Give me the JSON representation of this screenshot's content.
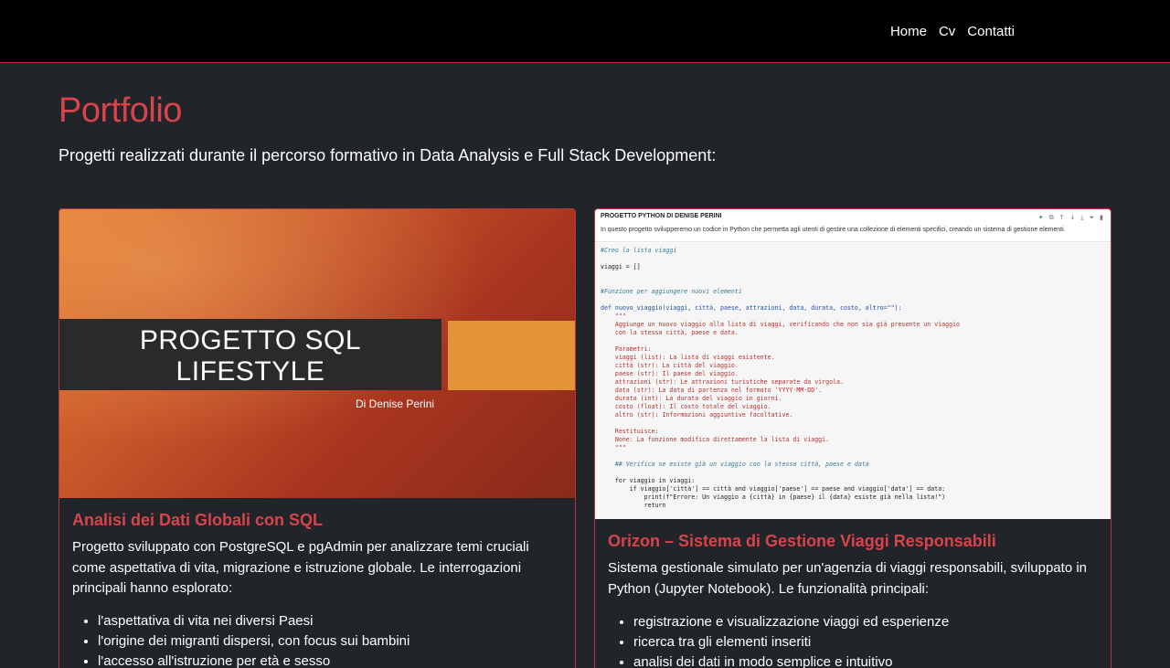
{
  "nav": {
    "items": [
      "Home",
      "Cv",
      "Contatti"
    ]
  },
  "page": {
    "title": "Portfolio",
    "intro": "Progetti realizzati durante il percorso formativo in Data Analysis e Full Stack Development:"
  },
  "projects": [
    {
      "slide_title": "PROGETTO SQL LIFESTYLE",
      "slide_byline": "Di Denise Perini",
      "title": "Analisi dei Dati Globali con SQL",
      "description": "Progetto sviluppato con PostgreSQL e pgAdmin per analizzare temi cruciali come aspettativa di vita, migrazione e istruzione globale. Le interrogazioni principali hanno esplorato:",
      "bullets": [
        "l'aspettativa di vita nei diversi Paesi",
        "l'origine dei migranti dispersi, con focus sui bambini",
        "l'accesso all'istruzione per età e sesso"
      ]
    },
    {
      "notebook_title": "PROGETTO PYTHON DI DENISE PERINI",
      "notebook_desc": "In questo progetto svilupperemo un codice in Python che permetta agli utenti di gestire una collezione di elementi specifici, creando un sistema di gestione elementi.",
      "notebook_code": [
        "#Creo la lista viaggi",
        "",
        "viaggi = []",
        "",
        "",
        "#Funzione per aggiungere nuovi elementi",
        "",
        "def nuovo_viaggio(viaggi, città, paese, attrazioni, data, durata, costo, altro=\"\"):",
        "    \"\"\"",
        "    Aggiunge un nuovo viaggio alla lista di viaggi, verificando che non sia già presente un viaggio",
        "    con la stessa città, paese e data.",
        "",
        "    Parametri:",
        "    viaggi (list): La lista di viaggi esistente.",
        "    città (str): La città del viaggio.",
        "    paese (str): Il paese del viaggio.",
        "    attrazioni (str): Le attrazioni turistiche separate da virgola.",
        "    data (str): La data di partenza nel formato 'YYYY-MM-DD'.",
        "    durata (int): La durata del viaggio in giorni.",
        "    costo (float): Il costo totale del viaggio.",
        "    altro (str): Informazioni aggiuntive facoltative.",
        "",
        "    Restituisce:",
        "    None: La funzione modifica direttamente la lista di viaggi.",
        "    \"\"\"",
        "",
        "    ## Verifica se esiste già un viaggio con la stessa città, paese e data",
        "",
        "    for viaggio in viaggi:",
        "        if viaggio['città'] == città and viaggio['paese'] == paese and viaggio['data'] == data:",
        "            print(f\"Errore: Un viaggio a {città} in {paese} il {data} esiste già nella lista!\")",
        "            return"
      ],
      "title": "Orizon – Sistema di Gestione Viaggi Responsabili",
      "description": "Sistema gestionale simulato per un'agenzia di viaggi responsabili, sviluppato in Python (Jupyter Notebook). Le funzionalità principali:",
      "bullets": [
        "registrazione e visualizzazione viaggi ed esperienze",
        "ricerca tra gli elementi inseriti",
        "analisi dei dati in modo semplice e intuitivo"
      ]
    }
  ],
  "colors": {
    "background": "#212529",
    "accent": "#d9434b",
    "navbar": "#000000"
  }
}
